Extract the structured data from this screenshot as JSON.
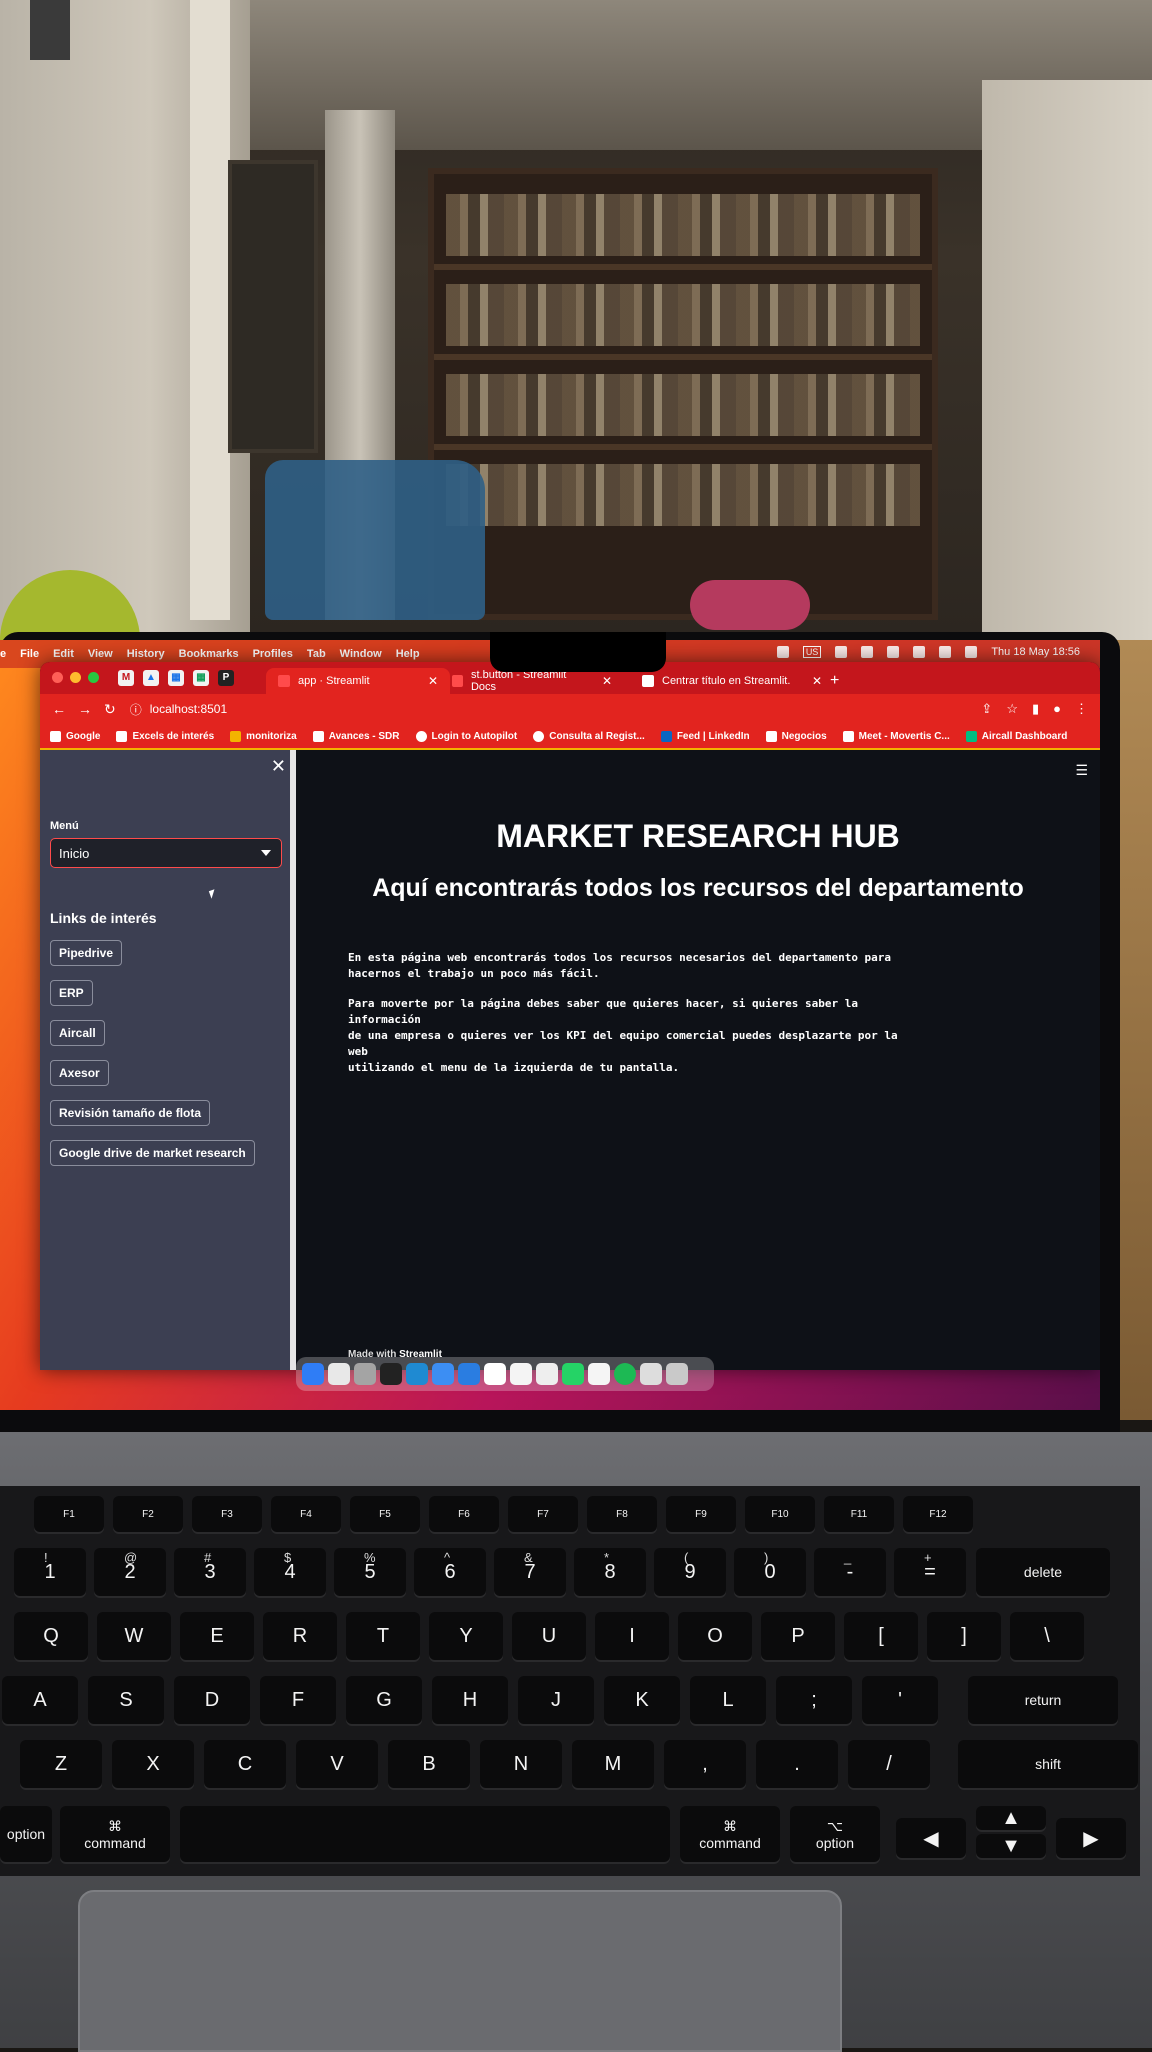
{
  "menubar": {
    "items": [
      "e",
      "File",
      "Edit",
      "View",
      "History",
      "Bookmarks",
      "Profiles",
      "Tab",
      "Window",
      "Help"
    ],
    "keyboard_layout": "US",
    "datetime": "Thu 18 May  18:56"
  },
  "browser": {
    "pinned_tabs": [
      "M",
      "▲",
      "▦",
      "▦",
      "P"
    ],
    "tabs": [
      {
        "label": "app · Streamlit",
        "active": true
      },
      {
        "label": "st.button - Streamlit Docs",
        "active": false
      },
      {
        "label": "Centrar título en Streamlit.",
        "active": false
      }
    ],
    "url": "localhost:8501",
    "bookmarks": [
      "Google",
      "Excels de interés",
      "monitoriza",
      "Avances - SDR",
      "Login to Autopilot",
      "Consulta al Regist...",
      "Feed | LinkedIn",
      "Negocios",
      "Meet - Movertis C...",
      "Aircall Dashboard"
    ]
  },
  "sidebar": {
    "menu_label": "Menú",
    "select_value": "Inicio",
    "links_heading": "Links de interés",
    "links": [
      "Pipedrive",
      "ERP",
      "Aircall",
      "Axesor",
      "Revisión tamaño de flota",
      "Google drive de market research"
    ]
  },
  "main": {
    "title": "MARKET RESEARCH HUB",
    "subtitle": "Aquí encontrarás todos los recursos del departamento",
    "paragraph1_line1": "En esta página web encontrarás todos los recursos necesarios del departamento para",
    "paragraph1_line2": "hacernos el trabajo un poco más fácil.",
    "paragraph2_line1": "Para moverte por la página debes saber que quieres hacer, si quieres saber la información",
    "paragraph2_line2": "de una empresa o quieres ver los KPI del equipo comercial puedes desplazarte por la web",
    "paragraph2_line3": "utilizando el menu de la izquierda de tu pantalla.",
    "footer_prefix": "Made with ",
    "footer_brand": "Streamlit"
  },
  "keyboard": {
    "fn_row": [
      "F1",
      "F2",
      "F3",
      "F4",
      "F5",
      "F6",
      "F7",
      "F8",
      "F9",
      "F10",
      "F11",
      "F12"
    ],
    "number_row": [
      "1",
      "2",
      "3",
      "4",
      "5",
      "6",
      "7",
      "8",
      "9",
      "0",
      "-",
      "="
    ],
    "number_row_shift": [
      "!",
      "@",
      "#",
      "$",
      "%",
      "^",
      "&",
      "*",
      "(",
      ")",
      "_",
      "+"
    ],
    "row_q": [
      "Q",
      "W",
      "E",
      "R",
      "T",
      "Y",
      "U",
      "I",
      "O",
      "P",
      "[",
      "]",
      "\\"
    ],
    "row_a": [
      "A",
      "S",
      "D",
      "F",
      "G",
      "H",
      "J",
      "K",
      "L",
      ";",
      "'"
    ],
    "row_z": [
      "Z",
      "X",
      "C",
      "V",
      "B",
      "N",
      "M",
      ",",
      ".",
      "/"
    ],
    "delete": "delete",
    "return": "return",
    "shift": "shift",
    "command_left": "command",
    "command_right": "command",
    "option_left": "option",
    "option_right": "option",
    "cmd_symbol": "⌘",
    "opt_symbol": "⌥"
  },
  "colors": {
    "browser_chrome": "#e2241f",
    "streamlit_accent": "#ff4b4b",
    "sidebar_bg": "#3c3f52",
    "app_bg": "#0e1117"
  }
}
